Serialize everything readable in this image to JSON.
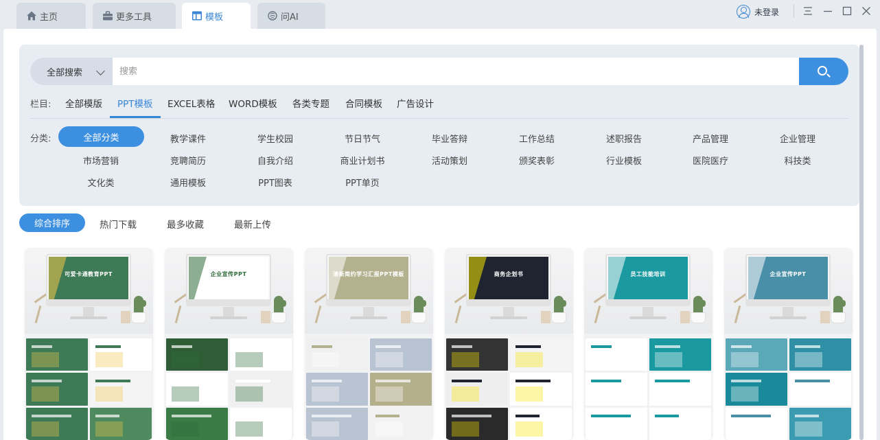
{
  "tabs": [
    {
      "label": "主页",
      "icon": "home-icon",
      "active": false
    },
    {
      "label": "更多工具",
      "icon": "toolbox-icon",
      "active": false
    },
    {
      "label": "模板",
      "icon": "template-icon",
      "active": true
    },
    {
      "label": "问AI",
      "icon": "ai-icon",
      "active": false
    }
  ],
  "user": {
    "login_label": "未登录"
  },
  "search": {
    "scope": "全部搜索",
    "placeholder": "搜索"
  },
  "columns": {
    "label": "栏目:",
    "items": [
      "全部模版",
      "PPT模板",
      "EXCEL表格",
      "WORD模板",
      "各类专题",
      "合同模板",
      "广告设计"
    ],
    "active": "PPT模板"
  },
  "categories": {
    "label": "分类:",
    "active": "全部分类",
    "items": [
      "全部分类",
      "教学课件",
      "学生校园",
      "节日节气",
      "毕业答辩",
      "工作总结",
      "述职报告",
      "产品管理",
      "企业管理",
      "市场营销",
      "竞聘简历",
      "自我介绍",
      "商业计划书",
      "活动策划",
      "颁奖表彰",
      "行业模板",
      "医院医疗",
      "科技类",
      "文化类",
      "通用模板",
      "PPT图表",
      "PPT单页"
    ]
  },
  "sort": {
    "items": [
      "综合排序",
      "热门下载",
      "最多收藏",
      "最新上传"
    ],
    "active": "综合排序"
  },
  "cards": [
    {
      "screen_text": "可爱卡通教育PPT",
      "theme": "#3e7a55",
      "accent": "#f0c64a",
      "text_color": "#ffffff",
      "slides": [
        "#3e7a55",
        "#ffffff",
        "#3e7a55",
        "#f4f4f4",
        "#3e7a55",
        "#4e8a5e"
      ]
    },
    {
      "screen_text": "企业宣传PPT",
      "theme": "#ffffff",
      "accent": "#2f6b3a",
      "text_color": "#2f6b3a",
      "slides": [
        "#2f5e36",
        "#ffffff",
        "#ffffff",
        "#f0f0f0",
        "#3b7a45",
        "#ffffff"
      ]
    },
    {
      "screen_text": "清新简约学习汇报PPT模板",
      "theme": "#b3b18e",
      "accent": "#ffffff",
      "text_color": "#ffffff",
      "slides": [
        "#f0f0f0",
        "#b9c4d3",
        "#b9c4d3",
        "#b5b08c",
        "#b9c4d3",
        "#f2f2f2"
      ]
    },
    {
      "screen_text": "商务企划书",
      "theme": "#1f2430",
      "accent": "#f5e600",
      "text_color": "#ffffff",
      "slides": [
        "#333333",
        "#f4f4f4",
        "#eeeeee",
        "#ffffff",
        "#2a2a2a",
        "#ffffff"
      ]
    },
    {
      "screen_text": "员工技能培训",
      "theme": "#1a9aa0",
      "accent": "#ffffff",
      "text_color": "#ffffff",
      "slides": [
        "#ffffff",
        "#1a9aa0",
        "#ffffff",
        "#ffffff",
        "#ffffff",
        "#ffffff"
      ]
    },
    {
      "screen_text": "企业宣传PPT",
      "theme": "#4a8fa8",
      "accent": "#ffffff",
      "text_color": "#ffffff",
      "slides": [
        "#5aa8b8",
        "#2f8fa5",
        "#1a8a9a",
        "#ffffff",
        "#ffffff",
        "#3b9bb0"
      ]
    }
  ]
}
